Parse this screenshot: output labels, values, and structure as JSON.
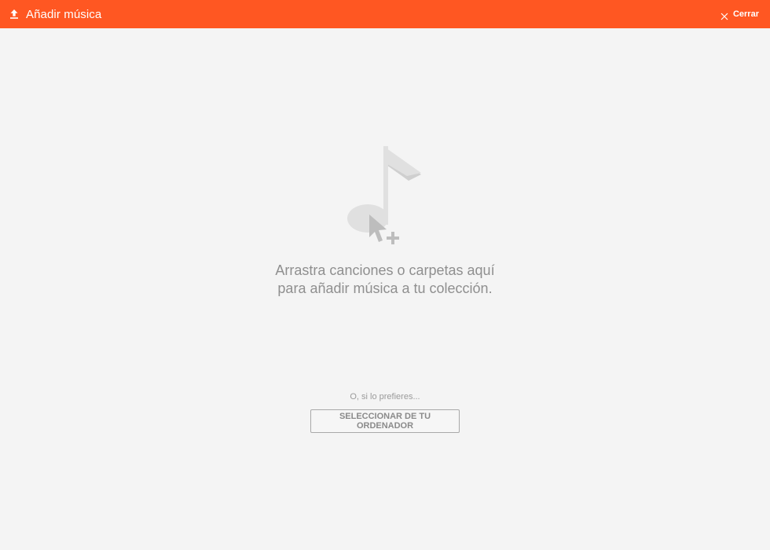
{
  "header": {
    "title": "Añadir música",
    "close_label": "Cerrar",
    "upload_icon": "upload-icon",
    "close_icon": "close-icon",
    "accent_color": "#ff5722"
  },
  "dropzone": {
    "illustration_icon": "music-note-cursor-plus-icon",
    "message": "Arrastra canciones o carpetas aquí para añadir música a tu colección.",
    "alternative_text": "O, si lo prefieres...",
    "select_button_label": "SELECCIONAR DE TU ORDENADOR"
  }
}
